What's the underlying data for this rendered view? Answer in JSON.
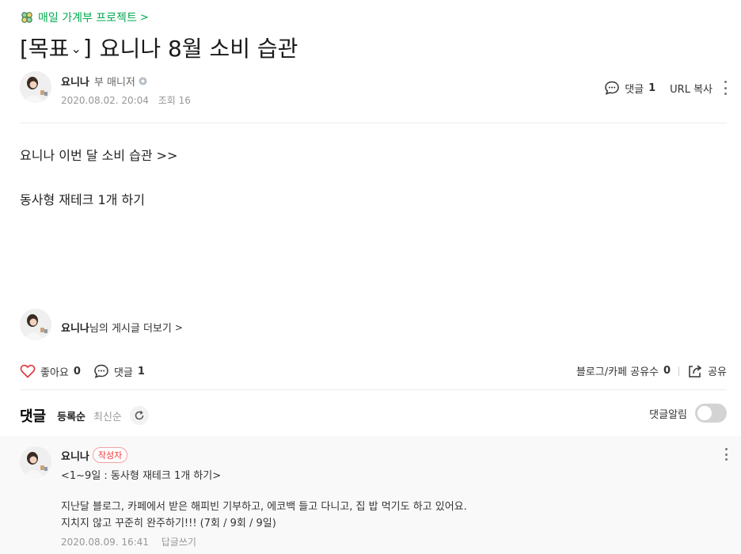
{
  "colors": {
    "brand_green": "#03a94f",
    "like_red": "#e0343d",
    "badge_red": "#f53535",
    "meta_gray": "#979797"
  },
  "header": {
    "board_link": "매일 가계부 프로젝트",
    "board_icon": "clover-icon",
    "title_tag": "[목표",
    "title_tag_close": "]",
    "title_text": "요니나 8월 소비 습관"
  },
  "author": {
    "name": "요니나",
    "role": "부 매니저",
    "date": "2020.08.02. 20:04",
    "views_label": "조회",
    "views": "16"
  },
  "top_actions": {
    "comment_label": "댓글",
    "comment_count": "1",
    "url_copy": "URL 복사"
  },
  "body": {
    "lines": [
      "요니나 이번 달 소비 습관 >>",
      "동사형 재테크 1개 하기"
    ]
  },
  "more_posts": {
    "name": "요니나",
    "suffix": "님의 게시글 더보기"
  },
  "reactions": {
    "like_label": "좋아요",
    "like_count": "0",
    "comment_label": "댓글",
    "comment_count": "1",
    "share_count_label": "블로그/카페 공유수",
    "share_count": "0",
    "share_label": "공유"
  },
  "comments_section": {
    "title": "댓글",
    "sort_registered": "등록순",
    "sort_latest": "최신순",
    "notify_label": "댓글알림",
    "notify_on": false
  },
  "comments": [
    {
      "author": "요니나",
      "badge": "작성자",
      "lines": [
        "<1~9일 : 동사형 재테크 1개 하기>",
        "지난달 블로그, 카페에서 받은 해피빈 기부하고, 에코백 들고 다니고, 집 밥 먹기도 하고 있어요.",
        "지치지 않고 꾸준히 완주하기!!! (7회 / 9회 / 9일)"
      ],
      "date": "2020.08.09. 16:41",
      "reply_label": "답글쓰기"
    }
  ]
}
